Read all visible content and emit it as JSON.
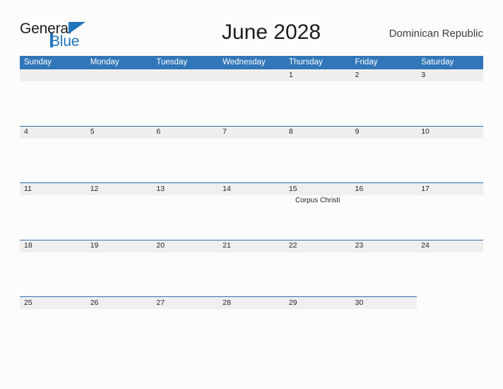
{
  "brand": {
    "name_part1": "General",
    "name_part2": "Blue",
    "logo_icon": "triangle-icon",
    "color_dark": "#1b1b1b",
    "color_blue": "#2175bd"
  },
  "header": {
    "title": "June 2028",
    "region": "Dominican Republic"
  },
  "theme": {
    "header_blue": "#3176b8",
    "row_border_blue": "#2e6fae",
    "band_gray": "#efefef",
    "page_background": "#fcfcfd"
  },
  "calendar": {
    "weekdays": [
      "Sunday",
      "Monday",
      "Tuesday",
      "Wednesday",
      "Thursday",
      "Friday",
      "Saturday"
    ],
    "weeks": [
      {
        "band_columns": 7,
        "days": [
          {
            "date": "",
            "events": []
          },
          {
            "date": "",
            "events": []
          },
          {
            "date": "",
            "events": []
          },
          {
            "date": "",
            "events": []
          },
          {
            "date": "1",
            "events": []
          },
          {
            "date": "2",
            "events": []
          },
          {
            "date": "3",
            "events": []
          }
        ]
      },
      {
        "band_columns": 7,
        "days": [
          {
            "date": "4",
            "events": []
          },
          {
            "date": "5",
            "events": []
          },
          {
            "date": "6",
            "events": []
          },
          {
            "date": "7",
            "events": []
          },
          {
            "date": "8",
            "events": []
          },
          {
            "date": "9",
            "events": []
          },
          {
            "date": "10",
            "events": []
          }
        ]
      },
      {
        "band_columns": 7,
        "days": [
          {
            "date": "11",
            "events": []
          },
          {
            "date": "12",
            "events": []
          },
          {
            "date": "13",
            "events": []
          },
          {
            "date": "14",
            "events": []
          },
          {
            "date": "15",
            "events": [
              "Corpus Christi"
            ]
          },
          {
            "date": "16",
            "events": []
          },
          {
            "date": "17",
            "events": []
          }
        ]
      },
      {
        "band_columns": 7,
        "days": [
          {
            "date": "18",
            "events": []
          },
          {
            "date": "19",
            "events": []
          },
          {
            "date": "20",
            "events": []
          },
          {
            "date": "21",
            "events": []
          },
          {
            "date": "22",
            "events": []
          },
          {
            "date": "23",
            "events": []
          },
          {
            "date": "24",
            "events": []
          }
        ]
      },
      {
        "band_columns": 6,
        "days": [
          {
            "date": "25",
            "events": []
          },
          {
            "date": "26",
            "events": []
          },
          {
            "date": "27",
            "events": []
          },
          {
            "date": "28",
            "events": []
          },
          {
            "date": "29",
            "events": []
          },
          {
            "date": "30",
            "events": []
          },
          {
            "date": "",
            "events": []
          }
        ]
      }
    ]
  }
}
